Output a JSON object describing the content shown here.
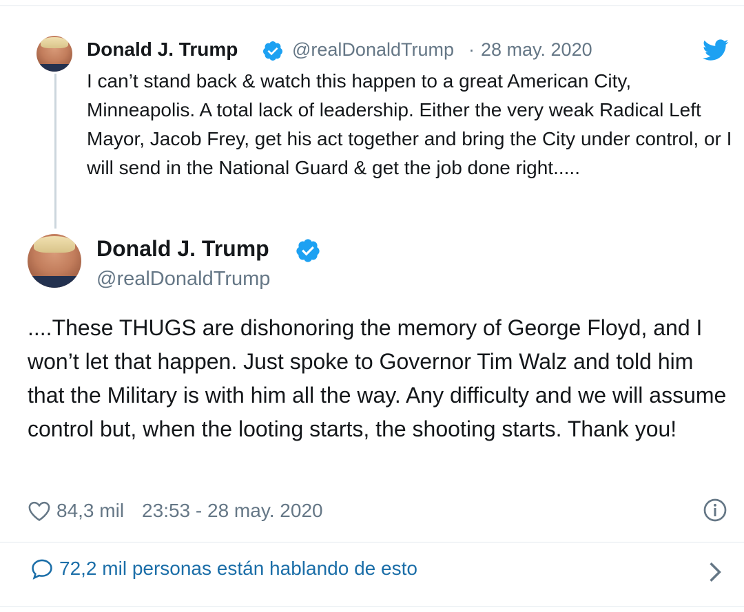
{
  "quoted": {
    "name": "Donald J. Trump",
    "handle": "@realDonaldTrump",
    "separator": "·",
    "date": "28 may. 2020",
    "text": "I can’t stand back & watch this happen to a great American City, Minneapolis. A total lack of leadership. Either the very weak Radical Left Mayor, Jacob Frey, get his act together and bring the City under control, or I will send in the National Guard & get the job done right....."
  },
  "tweet": {
    "name": "Donald J. Trump",
    "handle": "@realDonaldTrump",
    "text": "....These THUGS are dishonoring the memory of George Floyd, and I won’t let that happen. Just spoke to Governor Tim Walz and told him that the Military is with him all the way. Any difficulty and we will assume control but, when the looting starts, the shooting starts. Thank you!",
    "likes": "84,3 mil",
    "timestamp": "23:53 - 28 may. 2020"
  },
  "talking": {
    "text": "72,2 mil personas están hablando de esto"
  },
  "colors": {
    "accent": "#1da1f2",
    "verified": "#1da1f2",
    "muted": "#657786",
    "link": "#1b6ea8"
  },
  "icons": [
    "twitter-bird-icon",
    "verified-badge-icon",
    "heart-icon",
    "info-icon",
    "comment-bubble-icon",
    "chevron-right-icon"
  ]
}
